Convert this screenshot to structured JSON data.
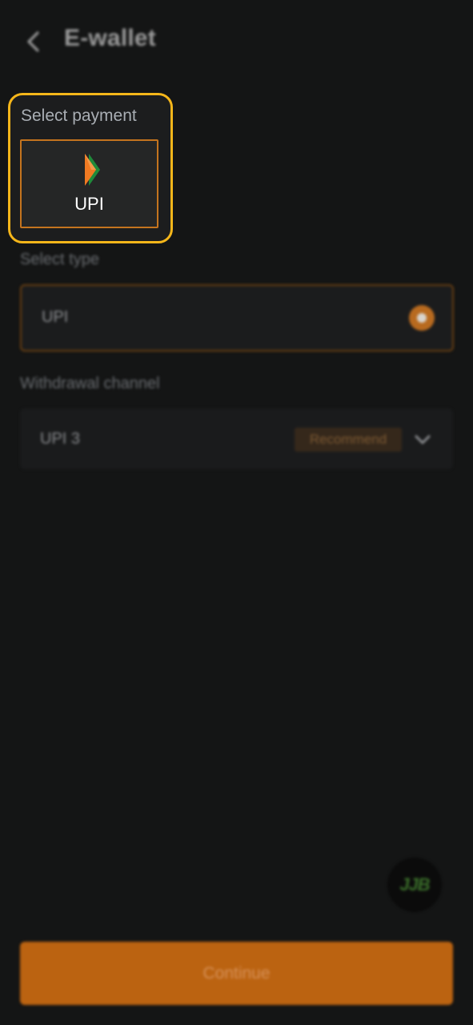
{
  "header": {
    "title": "E-wallet",
    "back_icon": "chevron-left-icon"
  },
  "select_payment": {
    "label": "Select payment",
    "options": [
      {
        "label": "UPI",
        "icon": "upi-logo-icon",
        "selected": true
      }
    ]
  },
  "select_type": {
    "label": "Select type",
    "value": "UPI",
    "selected": true
  },
  "withdrawal_channel": {
    "label": "Withdrawal channel",
    "value": "UPI 3",
    "badge": "Recommend",
    "dropdown_icon": "chevron-down-icon"
  },
  "floating_badge": {
    "text": "JJB",
    "icon": "support-logo-icon"
  },
  "actions": {
    "continue_label": "Continue"
  },
  "colors": {
    "accent": "#f5b61a",
    "primary_button": "#bb6311",
    "background": "#141515"
  }
}
